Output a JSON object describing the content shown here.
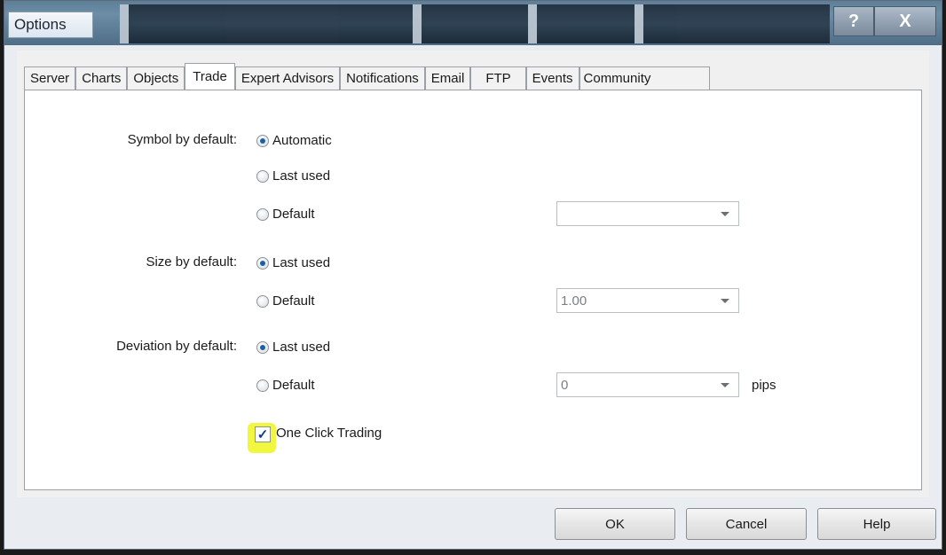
{
  "window": {
    "title": "Options",
    "help_glyph": "?",
    "close_glyph": "X"
  },
  "tabs": [
    {
      "label": "Server",
      "active": false
    },
    {
      "label": "Charts",
      "active": false
    },
    {
      "label": "Objects",
      "active": false
    },
    {
      "label": "Trade",
      "active": true
    },
    {
      "label": "Expert Advisors",
      "active": false
    },
    {
      "label": "Notifications",
      "active": false
    },
    {
      "label": "Email",
      "active": false
    },
    {
      "label": "FTP",
      "active": false
    },
    {
      "label": "Events",
      "active": false
    },
    {
      "label": "Community",
      "active": false
    }
  ],
  "trade": {
    "symbol_label": "Symbol by default:",
    "symbol_opt_automatic": "Automatic",
    "symbol_opt_last": "Last used",
    "symbol_opt_default": "Default",
    "symbol_selected": "automatic",
    "symbol_combo_value": "",
    "size_label": "Size by default:",
    "size_opt_last": "Last used",
    "size_opt_default": "Default",
    "size_selected": "last",
    "size_combo_value": "1.00",
    "deviation_label": "Deviation by default:",
    "deviation_opt_last": "Last used",
    "deviation_opt_default": "Default",
    "deviation_selected": "last",
    "deviation_combo_value": "0",
    "deviation_unit": "pips",
    "one_click_label": "One Click Trading",
    "one_click_checked": true,
    "highlight_color": "#f0f62a"
  },
  "buttons": {
    "ok": "OK",
    "cancel": "Cancel",
    "help": "Help"
  }
}
